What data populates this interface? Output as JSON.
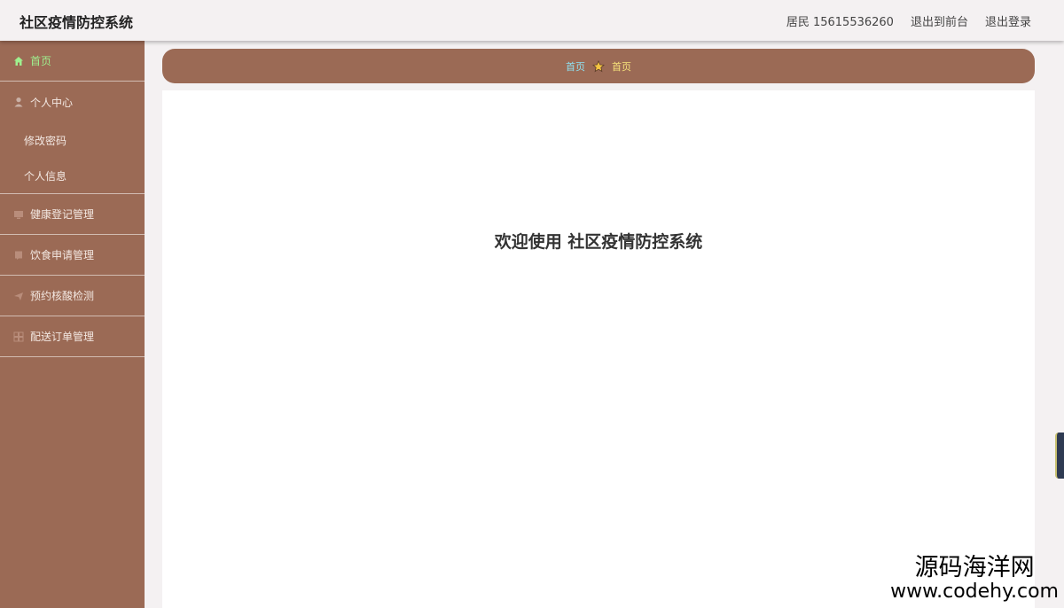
{
  "header": {
    "title": "社区疫情防控系统",
    "user_label": "居民 15615536260",
    "back_front_label": "退出到前台",
    "logout_label": "退出登录"
  },
  "sidebar": {
    "home": {
      "label": "首页",
      "icon": "home-icon"
    },
    "personal_center": {
      "label": "个人中心",
      "icon": "user-icon",
      "children": [
        {
          "label": "修改密码"
        },
        {
          "label": "个人信息"
        }
      ]
    },
    "items": [
      {
        "label": "健康登记管理",
        "icon": "monitor-icon"
      },
      {
        "label": "饮食申请管理",
        "icon": "document-icon"
      },
      {
        "label": "预约核酸检测",
        "icon": "send-icon"
      },
      {
        "label": "配送订单管理",
        "icon": "grid-icon"
      }
    ]
  },
  "breadcrumb": {
    "home_label": "首页",
    "separator_icon": "star-icon",
    "current_label": "首页"
  },
  "main": {
    "welcome_text": "欢迎使用 社区疫情防控系统"
  },
  "watermark": {
    "name": "源码海洋网",
    "url": "www.codehy.com"
  },
  "colors": {
    "sidebar_bg": "#9b6a55",
    "active_menu": "#9ff08f",
    "crumb_home": "#8fe0f0",
    "crumb_current": "#f7e27a"
  }
}
